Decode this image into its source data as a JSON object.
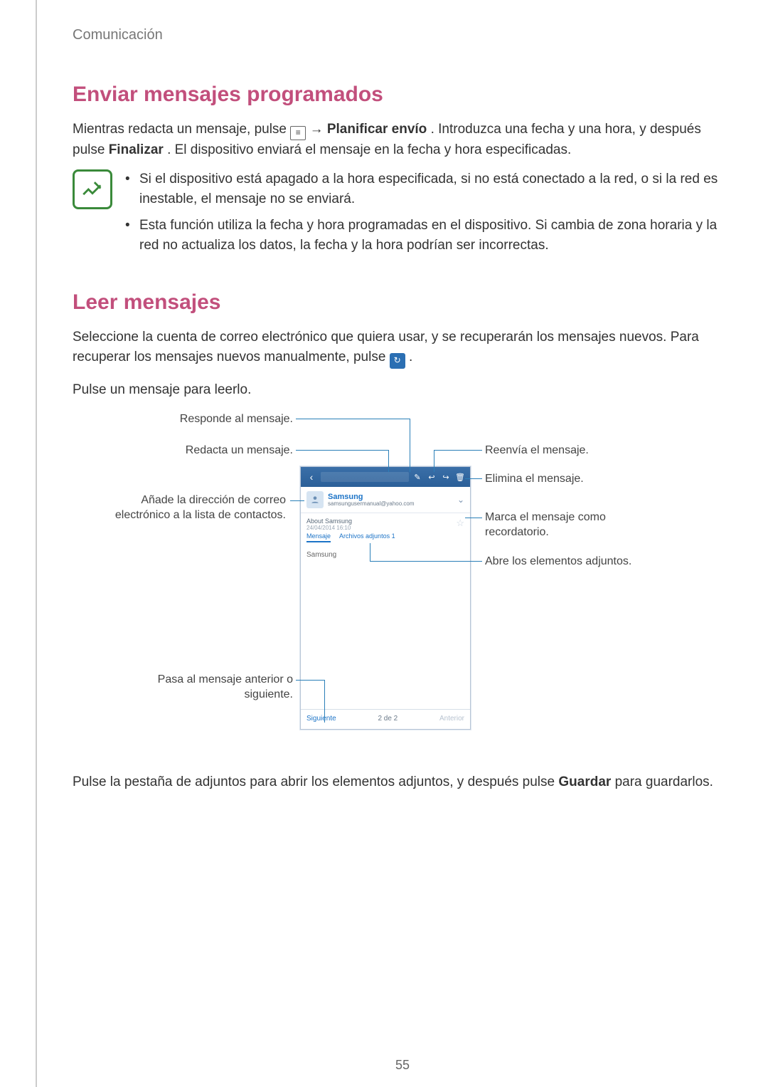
{
  "breadcrumb": "Comunicación",
  "page_number": "55",
  "section1": {
    "heading": "Enviar mensajes programados",
    "para_parts": {
      "p1a": "Mientras redacta un mensaje, pulse ",
      "p1b": " → ",
      "p1c": "Planificar envío",
      "p1d": ". Introduzca una fecha y una hora, y después pulse ",
      "p1e": "Finalizar",
      "p1f": ". El dispositivo enviará el mensaje en la fecha y hora especificadas."
    },
    "bullets": [
      "Si el dispositivo está apagado a la hora especificada, si no está conectado a la red, o si la red es inestable, el mensaje no se enviará.",
      "Esta función utiliza la fecha y hora programadas en el dispositivo. Si cambia de zona horaria y la red no actualiza los datos, la fecha y la hora podrían ser incorrectas."
    ]
  },
  "section2": {
    "heading": "Leer mensajes",
    "para1a": "Seleccione la cuenta de correo electrónico que quiera usar, y se recuperarán los mensajes nuevos. Para recuperar los mensajes nuevos manualmente, pulse ",
    "para1b": ".",
    "para2": "Pulse un mensaje para leerlo.",
    "para3a": "Pulse la pestaña de adjuntos para abrir los elementos adjuntos, y después pulse ",
    "para3b": "Guardar",
    "para3c": " para guardarlos."
  },
  "callouts": {
    "reply": "Responde al mensaje.",
    "compose": "Redacta un mensaje.",
    "add_contact": "Añade la dirección de correo electrónico a la lista de contactos.",
    "prev_next": "Pasa al mensaje anterior o siguiente.",
    "forward": "Reenvía el mensaje.",
    "delete": "Elimina el mensaje.",
    "reminder": "Marca el mensaje como recordatorio.",
    "attachments": "Abre los elementos adjuntos."
  },
  "phone": {
    "from_name": "Samsung",
    "from_email": "samsungusermanual@yahoo.com",
    "subject": "About Samsung",
    "date": "24/04/2014 16:10",
    "tab_message": "Mensaje",
    "tab_attach": "Archivos adjuntos 1",
    "body_text": "Samsung",
    "nav_prev": "Siguiente",
    "nav_count": "2 de 2",
    "nav_next": "Anterior"
  },
  "icons": {
    "menu_glyph": "≡",
    "refresh_glyph": "↻"
  }
}
